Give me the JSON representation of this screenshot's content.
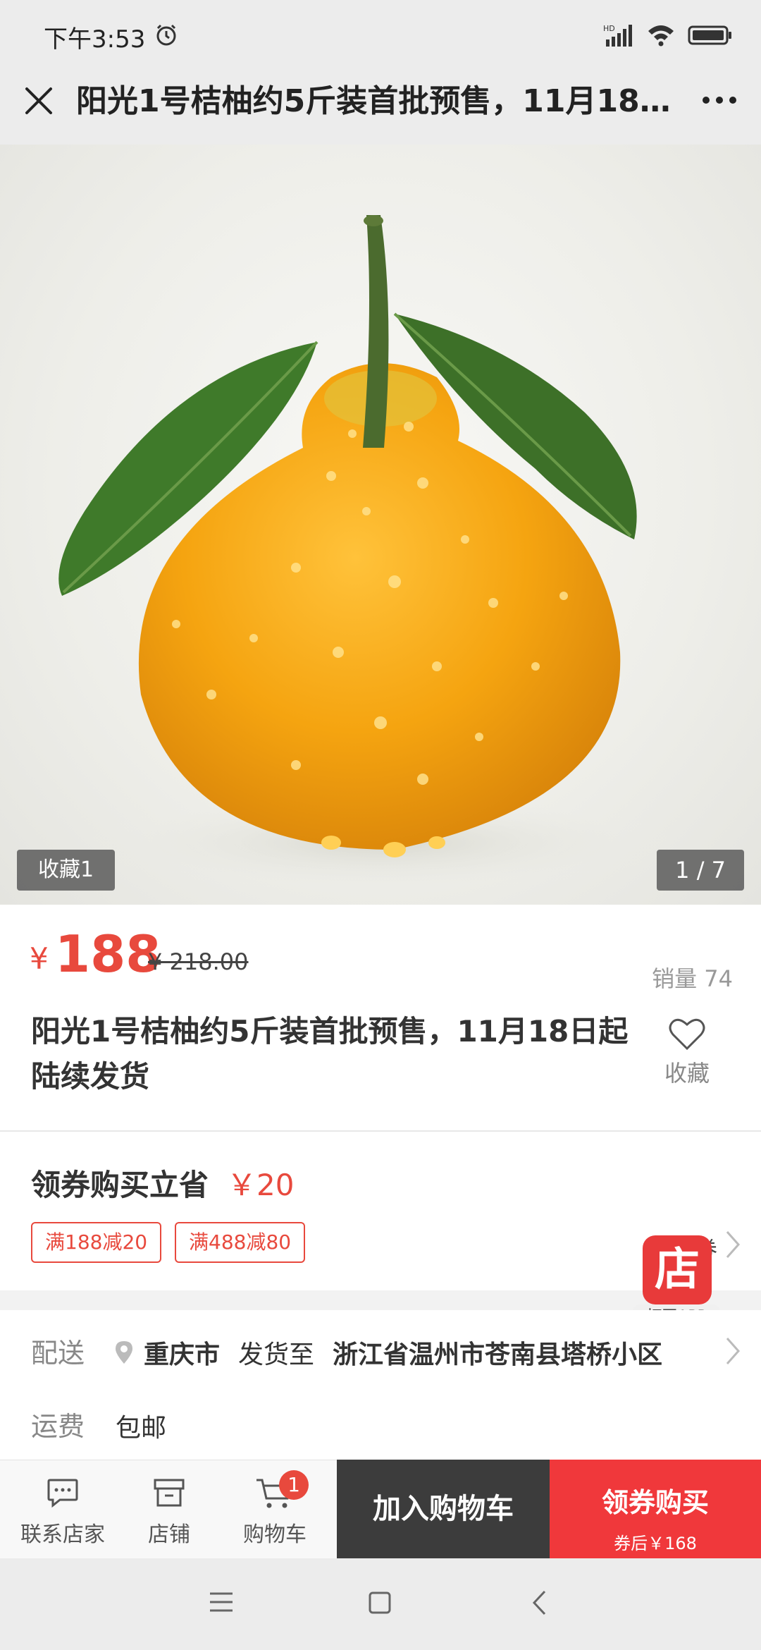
{
  "status": {
    "time": "下午3:53",
    "network_label": "HD"
  },
  "header": {
    "title": "阳光1号桔柚约5斤装首批预售，11月18日起陆续发货"
  },
  "gallery": {
    "favorite_badge": "收藏1",
    "page_indicator": "1 / 7"
  },
  "price": {
    "currency": "¥",
    "current": "188",
    "original": "¥ 218.00",
    "sales": "销量 74"
  },
  "product": {
    "name": "阳光1号桔柚约5斤装首批预售，11月18日起陆续发货",
    "favorite_label": "收藏"
  },
  "coupon": {
    "title": "领券购买立省",
    "save_amount": "￥20",
    "tags": [
      "满188减20",
      "满488减80"
    ],
    "collect_label": "领券"
  },
  "open_app": {
    "badge": "店",
    "label": "打开APP"
  },
  "delivery": {
    "label": "配送",
    "city": "重庆市",
    "ship_to": "发货至",
    "address": "浙江省温州市苍南县塔桥小区",
    "freight_label": "运费",
    "freight_value": "包邮"
  },
  "bottom_bar": {
    "contact": "联系店家",
    "shop": "店铺",
    "cart": "购物车",
    "cart_count": "1",
    "add_to_cart": "加入购物车",
    "buy": "领券购买",
    "buy_sub": "券后￥168"
  },
  "colors": {
    "accent": "#e8493d",
    "buy_button": "#f0383b",
    "cart_button": "#3c3c3c"
  }
}
